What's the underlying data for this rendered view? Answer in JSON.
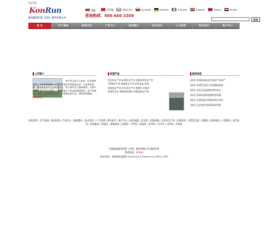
{
  "topbar": {
    "text": "欢迎光临"
  },
  "logo": {
    "mark_left": "Kon",
    "mark_right": "Run",
    "sub": "康润建材机械（平阳）股份有限公司"
  },
  "hotline": {
    "top": "热线",
    "label": "咨询热线：",
    "number": "400-660-3309"
  },
  "languages": [
    {
      "flag": "cn",
      "label": "中文版"
    },
    {
      "flag": "en",
      "label": "ENGLISH"
    },
    {
      "flag": "ru",
      "label": "русский"
    },
    {
      "flag": "de",
      "label": "Deutsch"
    },
    {
      "flag": "fr",
      "label": "Français"
    },
    {
      "flag": "es",
      "label": "Español"
    },
    {
      "flag": "tr",
      "label": "Türkçe"
    },
    {
      "flag": "ar",
      "label": "Arabic"
    }
  ],
  "search": {
    "placeholder": "",
    "button": "搜索"
  },
  "nav": [
    "首 页",
    "关于康润",
    "新闻动态",
    "产品中心",
    "案例展示",
    "技术支持",
    "人力资源",
    "联系我们",
    "客户中心"
  ],
  "about": {
    "title": "公司简介",
    "text": "本公司从事人力资本，以稳健求发展，以创新求发展。公司始终坚持以质量求生存，以信誉求发展，积极推进现代企业制度建设，努力提高员工整体素质，为客户提供优质的产品和服务。本公司致力于建材机械的研发、生产和销售，坚持以技术创新为先导，不断推出新产品，满足市场需求。",
    "more": "[详细信息]"
  },
  "products": {
    "title": "热销产品",
    "lines": [
      "压瓦机生产线  彩钢瓦生产线  双层彩钢瓦生产线",
      "C型钢生产线  楼承板生产线  彩钢设备 机械",
      "岩棉板生产线  夹芯板生产线  角驰机 扣板机",
      "彩钢压瓦机  屋面板成型机  彩钢设备生产线"
    ]
  },
  "news": {
    "title": "新闻动态",
    "items": [
      "[新闻] 康润机械全新升级生产线投产",
      "[新闻] 彩钢压瓦机行业发展新趋势",
      "[新闻] 压瓦机设备维护保养常识",
      "[新闻] 康润机械参加国际建材展",
      "[新闻] 彩钢设备市场需求稳步增长",
      "[新闻] 企业技术创新取得新突破"
    ]
  },
  "footer": {
    "links": "网站首页 | 关于康润 | 新闻动态 | 产品中心 | 案例展示 | 技术支持 | 人力资源 | 联系我们 | 客户中心 | 网站地图 | 压瓦机 | 彩钢设备 | 压瓦机生产线 | 彩钢瓦机 | 双层压瓦机 | 角驰机 | 楼承板机 | C型钢机 | 夹芯板机 | 岩棉板机 | 扣板机 | 屋面板机 | 成型机 | 冷弯机 | 剪板机 | 折弯机 | 开平机 | 分条机 | 纵剪机",
    "copy_1": "中国康润建材机械（平阳）股份有限公司 版权所有",
    "hotline_label": "热线电话：",
    "hotline": "87654",
    "copy_2": "技术支持：互联网信息服务 Designed & Powered by WELL LINK"
  },
  "colors": {
    "brand_red": "#c0272d",
    "brand_blue": "#1f4f9a",
    "nav_gray": "#6c6c6c"
  }
}
